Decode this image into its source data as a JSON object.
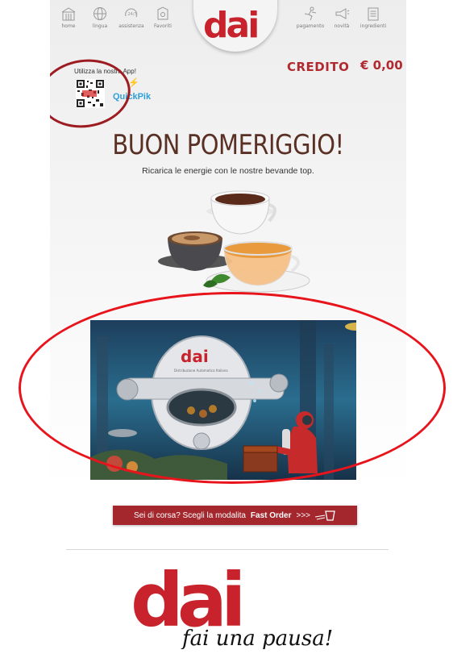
{
  "nav": {
    "left": [
      {
        "label": "home",
        "icon": "building-icon"
      },
      {
        "label": "lingua",
        "icon": "globe-icon"
      },
      {
        "label": "assistenza",
        "icon": "24-7-icon"
      },
      {
        "label": "Favoriti",
        "icon": "favorites-icon"
      }
    ],
    "right": [
      {
        "label": "pagamento",
        "icon": "payment-icon"
      },
      {
        "label": "novità",
        "icon": "megaphone-icon"
      },
      {
        "label": "ingredienti",
        "icon": "ingredients-icon"
      }
    ],
    "logo": "dai"
  },
  "credit": {
    "label": "CREDITO",
    "value": "€ 0,00"
  },
  "app_promo": {
    "text": "Utilizza la nostra App!",
    "app_name": "QuickPik"
  },
  "greeting": "BUON POMERIGGIO!",
  "subtitle": "Ricarica le energie con le nostre bevande top.",
  "hero": {
    "brand": "dai",
    "caption": "Distribuzione Automatica Italiana"
  },
  "fast_order": {
    "text": "Sei di corsa? Scegli la modalita",
    "bold": "Fast Order",
    "arrows": ">>>"
  },
  "footer": {
    "logo": "dai",
    "tagline": "fai una pausa!"
  },
  "colors": {
    "brand_red": "#c8232c",
    "button_red": "#a3272d",
    "greeting_brown": "#5a3025",
    "annotation_red": "#e8141c"
  }
}
